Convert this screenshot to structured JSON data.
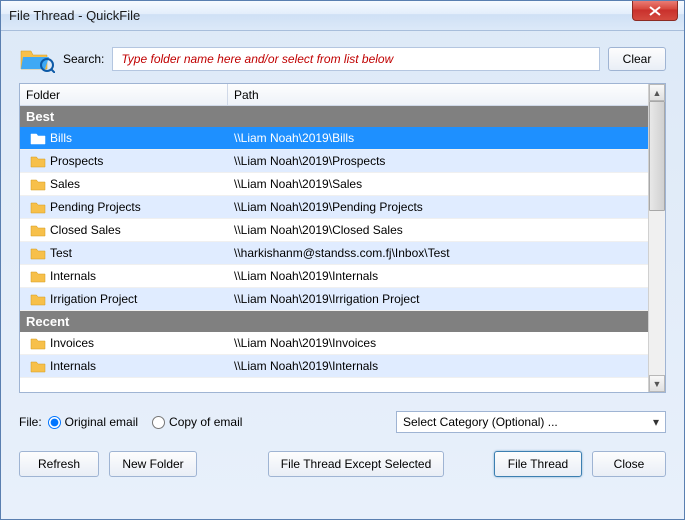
{
  "window": {
    "title": "File Thread - QuickFile"
  },
  "search": {
    "label": "Search:",
    "placeholder": "Type folder name here and/or select from list below",
    "clear": "Clear"
  },
  "columns": {
    "folder": "Folder",
    "path": "Path"
  },
  "groups": {
    "best": {
      "label": "Best",
      "rows": [
        {
          "folder": "Bills",
          "path": "\\\\Liam Noah\\2019\\Bills",
          "selected": true
        },
        {
          "folder": "Prospects",
          "path": "\\\\Liam Noah\\2019\\Prospects"
        },
        {
          "folder": "Sales",
          "path": "\\\\Liam Noah\\2019\\Sales"
        },
        {
          "folder": "Pending Projects",
          "path": "\\\\Liam Noah\\2019\\Pending Projects"
        },
        {
          "folder": "Closed Sales",
          "path": "\\\\Liam Noah\\2019\\Closed Sales"
        },
        {
          "folder": "Test",
          "path": "\\\\harkishanm@standss.com.fj\\Inbox\\Test"
        },
        {
          "folder": "Internals",
          "path": "\\\\Liam Noah\\2019\\Internals"
        },
        {
          "folder": "Irrigation Project",
          "path": "\\\\Liam Noah\\2019\\Irrigation Project"
        }
      ]
    },
    "recent": {
      "label": "Recent",
      "rows": [
        {
          "folder": "Invoices",
          "path": "\\\\Liam Noah\\2019\\Invoices"
        },
        {
          "folder": "Internals",
          "path": "\\\\Liam Noah\\2019\\Internals"
        }
      ]
    }
  },
  "file_options": {
    "label": "File:",
    "original": "Original email",
    "copy": "Copy of email",
    "selected": "original"
  },
  "category": {
    "placeholder": "Select Category (Optional) ..."
  },
  "buttons": {
    "refresh": "Refresh",
    "new_folder": "New Folder",
    "except": "File Thread Except Selected",
    "file_thread": "File Thread",
    "close": "Close"
  }
}
